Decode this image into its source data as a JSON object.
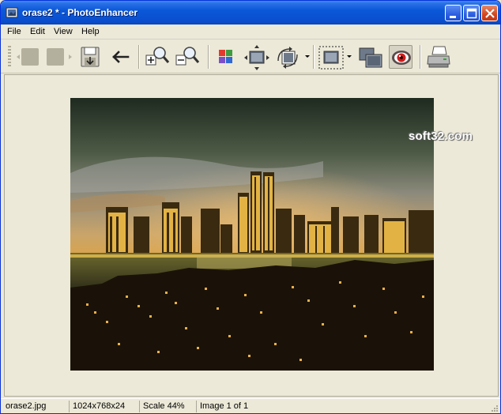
{
  "window": {
    "title": "orase2 * - PhotoEnhancer",
    "minimize_icon": "minimize-icon",
    "maximize_icon": "maximize-icon",
    "close_icon": "close-icon"
  },
  "menu": {
    "items": [
      {
        "label": "File"
      },
      {
        "label": "Edit"
      },
      {
        "label": "View"
      },
      {
        "label": "Help"
      }
    ]
  },
  "toolbar": {
    "buttons": [
      {
        "icon": "back-disabled-icon"
      },
      {
        "icon": "forward-disabled-icon"
      },
      {
        "icon": "save-icon"
      },
      {
        "icon": "undo-arrow-icon"
      },
      {
        "icon": "zoom-in-icon"
      },
      {
        "icon": "zoom-out-icon"
      },
      {
        "icon": "color-palette-icon"
      },
      {
        "icon": "resize-icon"
      },
      {
        "icon": "rotate-icon"
      },
      {
        "icon": "crop-icon"
      },
      {
        "icon": "compare-icon"
      },
      {
        "icon": "red-eye-icon"
      },
      {
        "icon": "print-icon"
      }
    ]
  },
  "image": {
    "watermark": "soft32.com"
  },
  "status": {
    "filename": "orase2.jpg",
    "dimensions": "1024x768x24",
    "scale": "Scale 44%",
    "page": "Image 1 of 1"
  },
  "colors": {
    "titlebar": "#0A58D8",
    "chrome": "#ECE9D8",
    "close_button": "#D2461F"
  }
}
